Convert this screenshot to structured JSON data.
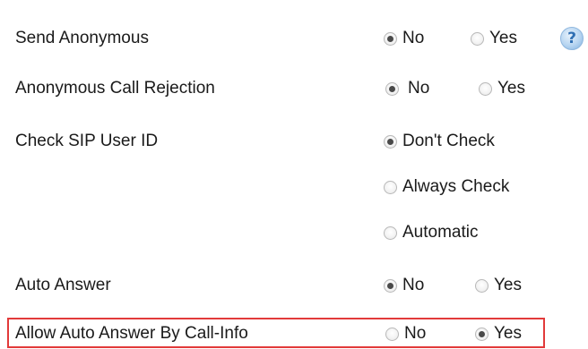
{
  "rows": {
    "send_anonymous": {
      "label": "Send Anonymous",
      "options": [
        "No",
        "Yes"
      ],
      "selected": "No"
    },
    "anonymous_call_rejection": {
      "label": "Anonymous Call Rejection",
      "options": [
        "No",
        "Yes"
      ],
      "selected": "No"
    },
    "check_sip_user_id": {
      "label": "Check SIP User ID",
      "options": [
        "Don't Check",
        "Always Check",
        "Automatic"
      ],
      "selected": "Don't Check"
    },
    "auto_answer": {
      "label": "Auto Answer",
      "options": [
        "No",
        "Yes"
      ],
      "selected": "No"
    },
    "allow_auto_answer_by_call_info": {
      "label": "Allow Auto Answer By Call-Info",
      "options": [
        "No",
        "Yes"
      ],
      "selected": "Yes"
    }
  },
  "icons": {
    "help": "help-icon",
    "help_glyph": "?"
  },
  "colors": {
    "highlight_border": "#e23a3a",
    "help_icon": "#2f6fb3",
    "radio_dot": "#4a4a4a"
  }
}
